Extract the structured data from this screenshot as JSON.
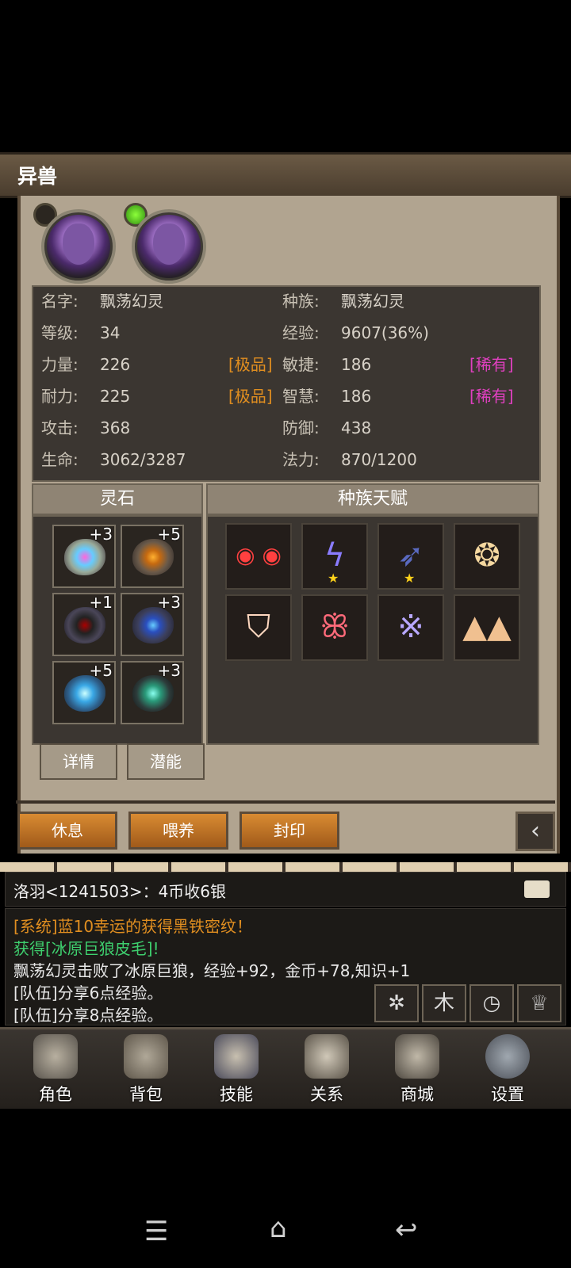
{
  "header": {
    "title": "异兽"
  },
  "stats": {
    "name_label": "名字:",
    "name": "飘荡幻灵",
    "race_label": "种族:",
    "race": "飘荡幻灵",
    "level_label": "等级:",
    "level": "34",
    "exp_label": "经验:",
    "exp": "9607(36%)",
    "str_label": "力量:",
    "str": "226",
    "str_grade": "[极品]",
    "agi_label": "敏捷:",
    "agi": "186",
    "agi_grade": "[稀有]",
    "sta_label": "耐力:",
    "sta": "225",
    "sta_grade": "[极品]",
    "int_label": "智慧:",
    "int": "186",
    "int_grade": "[稀有]",
    "atk_label": "攻击:",
    "atk": "368",
    "def_label": "防御:",
    "def": "438",
    "hp_label": "生命:",
    "hp": "3062/3287",
    "mp_label": "法力:",
    "mp": "870/1200"
  },
  "spirit_stones": {
    "title": "灵石",
    "items": [
      {
        "bonus": "+3",
        "icon": "rainbow-rune-stone"
      },
      {
        "bonus": "+5",
        "icon": "fire-rune-stone"
      },
      {
        "bonus": "+1",
        "icon": "dark-rune-stone"
      },
      {
        "bonus": "+3",
        "icon": "lightning-rune-stone"
      },
      {
        "bonus": "+5",
        "icon": "ice-rune-stone"
      },
      {
        "bonus": "+3",
        "icon": "shield-rune-stone"
      }
    ],
    "details_label": "详情",
    "potential_label": "潜能"
  },
  "racial_talents": {
    "title": "种族天赋",
    "items": [
      "eyes-icon",
      "lightning-bolt-icon",
      "wing-icon",
      "eagle-icon",
      "fire-shield-icon",
      "butterfly-icon",
      "bird-sigil-icon",
      "mountains-icon"
    ]
  },
  "actions": {
    "rest": "休息",
    "feed": "喂养",
    "seal": "封印"
  },
  "chat": {
    "top_message": "洛羽<1241503>：4币收6银",
    "lines": [
      {
        "text": "[系统]蓝10幸运的获得黑铁密纹！",
        "color": "#e08e20"
      },
      {
        "text": "获得[冰原巨狼皮毛]!",
        "color": "#3ecf6e"
      },
      {
        "text": "飘荡幻灵击败了冰原巨狼，经验+92，金币+78,知识+1",
        "color": "#e8e8e8"
      },
      {
        "text": "[队伍]分享6点经验。",
        "color": "#e8e8e8"
      },
      {
        "text": "[队伍]分享8点经验。",
        "color": "#e8e8e8"
      }
    ]
  },
  "nav": {
    "items": [
      {
        "label": "角色",
        "icon": "helmet-icon"
      },
      {
        "label": "背包",
        "icon": "backpack-icon"
      },
      {
        "label": "技能",
        "icon": "skill-book-icon"
      },
      {
        "label": "关系",
        "icon": "handshake-icon"
      },
      {
        "label": "商城",
        "icon": "treasure-chest-icon"
      },
      {
        "label": "设置",
        "icon": "gear-icon"
      }
    ]
  },
  "colors": {
    "orange": "#e08e20",
    "magenta": "#e040c0",
    "green": "#3ecf6e"
  }
}
